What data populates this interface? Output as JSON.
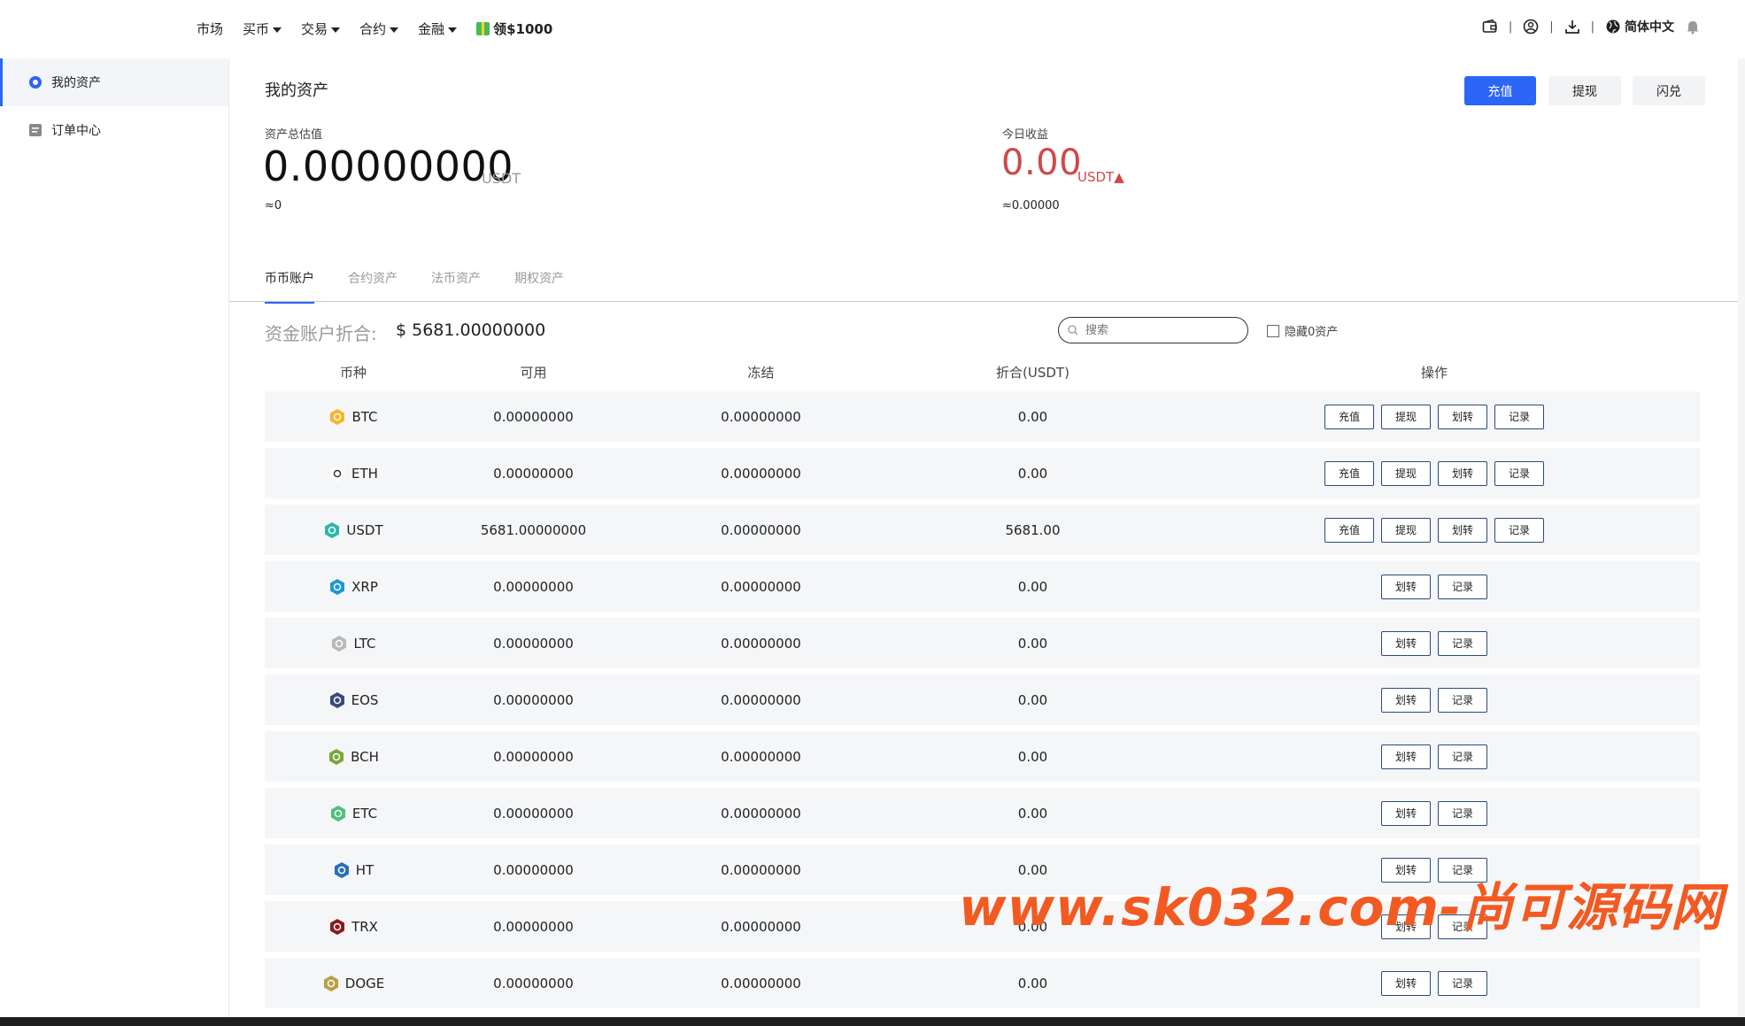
{
  "header": {
    "nav": [
      {
        "label": "市场",
        "caret": false
      },
      {
        "label": "买币",
        "caret": true
      },
      {
        "label": "交易",
        "caret": true
      },
      {
        "label": "合约",
        "caret": true
      },
      {
        "label": "金融",
        "caret": true
      }
    ],
    "promo_label": "领$1000",
    "language_label": "简体中文"
  },
  "sidebar": {
    "items": [
      {
        "label": "我的资产"
      },
      {
        "label": "订单中心"
      }
    ]
  },
  "main": {
    "title": "我的资产",
    "buttons": {
      "deposit": "充值",
      "withdraw": "提现",
      "exchange": "闪兑"
    },
    "total_label": "资产总估值",
    "total_value": "0.00000000",
    "total_unit": "USDT",
    "total_approx": "≈0",
    "today_label": "今日收益",
    "today_value": "0.00",
    "today_unit": "USDT▲",
    "today_approx": "≈0.00000",
    "tabs": [
      "币币账户",
      "合约资产",
      "法币资产",
      "期权资产"
    ],
    "fund_label": "资金账户折合:",
    "fund_value": "$ 5681.00000000",
    "search_placeholder": "搜索",
    "hide_zero_label": "隐藏0资产",
    "table": {
      "headers": [
        "币种",
        "可用",
        "冻结",
        "折合(USDT)",
        "操作"
      ],
      "op_labels": {
        "deposit": "充值",
        "withdraw": "提现",
        "transfer": "划转",
        "record": "记录"
      },
      "rows": [
        {
          "coin": "BTC",
          "available": "0.00000000",
          "frozen": "0.00000000",
          "usdt": "0.00",
          "ops": [
            "充值",
            "提现",
            "划转",
            "记录"
          ]
        },
        {
          "coin": "ETH",
          "available": "0.00000000",
          "frozen": "0.00000000",
          "usdt": "0.00",
          "ops": [
            "充值",
            "提现",
            "划转",
            "记录"
          ]
        },
        {
          "coin": "USDT",
          "available": "5681.00000000",
          "frozen": "0.00000000",
          "usdt": "5681.00",
          "ops": [
            "充值",
            "提现",
            "划转",
            "记录"
          ]
        },
        {
          "coin": "XRP",
          "available": "0.00000000",
          "frozen": "0.00000000",
          "usdt": "0.00",
          "ops": [
            "划转",
            "记录"
          ]
        },
        {
          "coin": "LTC",
          "available": "0.00000000",
          "frozen": "0.00000000",
          "usdt": "0.00",
          "ops": [
            "划转",
            "记录"
          ]
        },
        {
          "coin": "EOS",
          "available": "0.00000000",
          "frozen": "0.00000000",
          "usdt": "0.00",
          "ops": [
            "划转",
            "记录"
          ]
        },
        {
          "coin": "BCH",
          "available": "0.00000000",
          "frozen": "0.00000000",
          "usdt": "0.00",
          "ops": [
            "划转",
            "记录"
          ]
        },
        {
          "coin": "ETC",
          "available": "0.00000000",
          "frozen": "0.00000000",
          "usdt": "0.00",
          "ops": [
            "划转",
            "记录"
          ]
        },
        {
          "coin": "HT",
          "available": "0.00000000",
          "frozen": "0.00000000",
          "usdt": "0.00",
          "ops": [
            "划转",
            "记录"
          ]
        },
        {
          "coin": "TRX",
          "available": "0.00000000",
          "frozen": "0.00000000",
          "usdt": "0.00",
          "ops": [
            "划转",
            "记录"
          ]
        },
        {
          "coin": "DOGE",
          "available": "0.00000000",
          "frozen": "0.00000000",
          "usdt": "0.00",
          "ops": [
            "划转",
            "记录"
          ]
        }
      ]
    }
  },
  "watermark": "www.sk032.com-尚可源码网",
  "colors": {
    "primary": "#2c66f6",
    "red": "#d04848",
    "watermark": "#f25a22"
  }
}
